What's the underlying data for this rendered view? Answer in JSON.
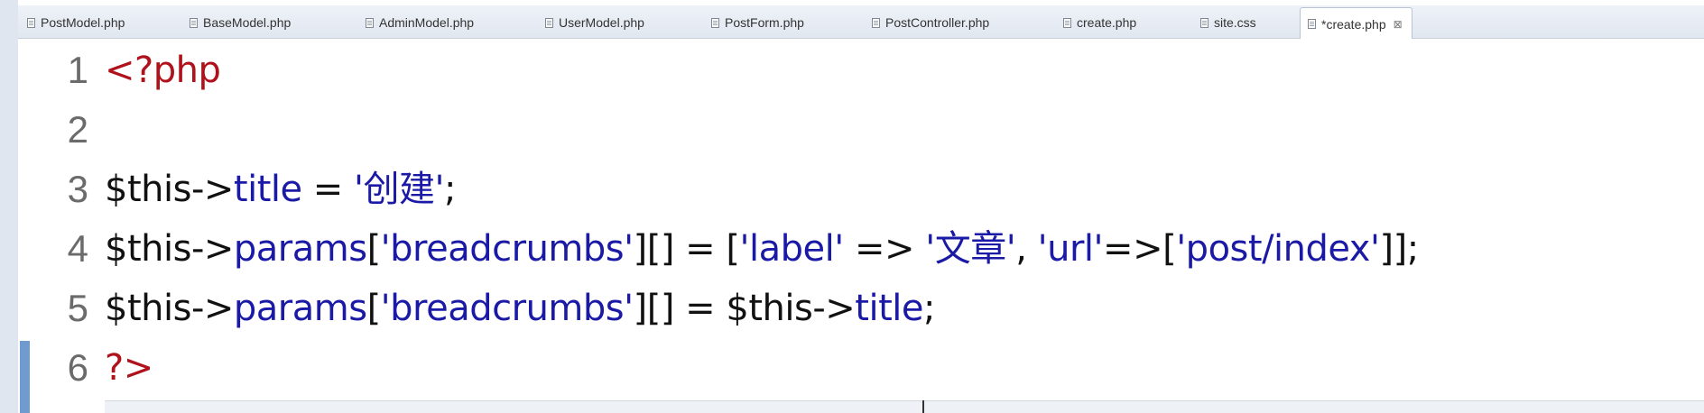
{
  "tabs": [
    {
      "label": "PostModel.php",
      "active": false
    },
    {
      "label": "BaseModel.php",
      "active": false
    },
    {
      "label": "AdminModel.php",
      "active": false
    },
    {
      "label": "UserModel.php",
      "active": false
    },
    {
      "label": "PostForm.php",
      "active": false
    },
    {
      "label": "PostController.php",
      "active": false
    },
    {
      "label": "create.php",
      "active": false
    },
    {
      "label": "site.css",
      "active": false
    },
    {
      "label": "*create.php",
      "active": true
    }
  ],
  "close_glyph": "⊠",
  "lines": [
    {
      "number": "1",
      "tokens": [
        {
          "text": "<?php",
          "kind": "kw"
        }
      ]
    },
    {
      "number": "2",
      "tokens": []
    },
    {
      "number": "3",
      "tokens": [
        {
          "text": "$this->",
          "kind": "var"
        },
        {
          "text": "title",
          "kind": "prop"
        },
        {
          "text": " = ",
          "kind": "op"
        },
        {
          "text": "'创建'",
          "kind": "str"
        },
        {
          "text": ";",
          "kind": "op"
        }
      ]
    },
    {
      "number": "4",
      "tokens": [
        {
          "text": "$this->",
          "kind": "var"
        },
        {
          "text": "params",
          "kind": "prop"
        },
        {
          "text": "[",
          "kind": "op"
        },
        {
          "text": "'breadcrumbs'",
          "kind": "str"
        },
        {
          "text": "][] = [",
          "kind": "op"
        },
        {
          "text": "'label'",
          "kind": "str"
        },
        {
          "text": " => ",
          "kind": "op"
        },
        {
          "text": "'文章'",
          "kind": "str"
        },
        {
          "text": ", ",
          "kind": "op"
        },
        {
          "text": "'url'",
          "kind": "str"
        },
        {
          "text": "=>[",
          "kind": "op"
        },
        {
          "text": "'post/index'",
          "kind": "str"
        },
        {
          "text": "]];",
          "kind": "op"
        }
      ]
    },
    {
      "number": "5",
      "tokens": [
        {
          "text": "$this->",
          "kind": "var"
        },
        {
          "text": "params",
          "kind": "prop"
        },
        {
          "text": "[",
          "kind": "op"
        },
        {
          "text": "'breadcrumbs'",
          "kind": "str"
        },
        {
          "text": "][] = ",
          "kind": "op"
        },
        {
          "text": "$this->",
          "kind": "var"
        },
        {
          "text": "title",
          "kind": "prop"
        },
        {
          "text": ";",
          "kind": "op"
        }
      ]
    },
    {
      "number": "6",
      "tokens": [
        {
          "text": "?>",
          "kind": "kw"
        }
      ]
    }
  ],
  "colors": {
    "keyword": "#b0121b",
    "property": "#1a1aa6",
    "string": "#1a1aa6",
    "line_number": "#6b6b6b"
  }
}
